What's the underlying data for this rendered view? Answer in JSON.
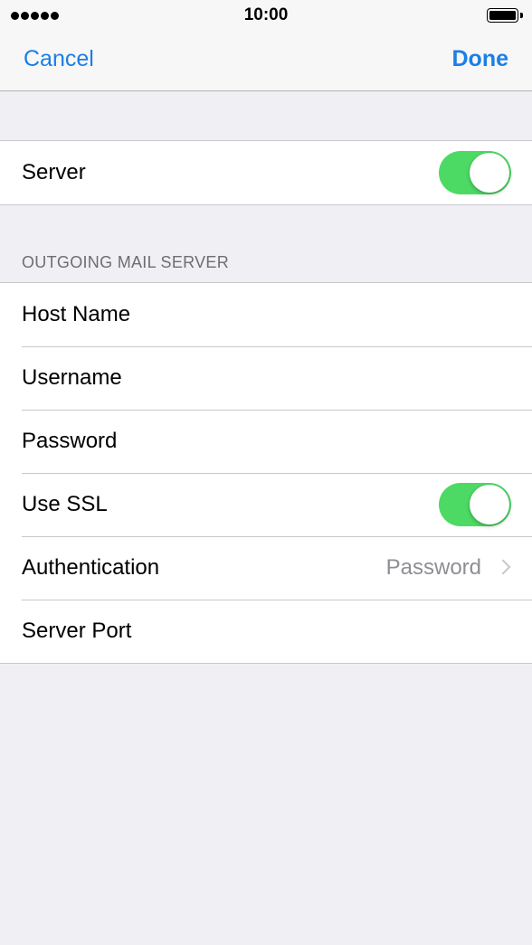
{
  "status_bar": {
    "time": "10:00",
    "signal_icon": "signal-dots-icon",
    "battery_icon": "battery-full-icon"
  },
  "nav": {
    "cancel_label": "Cancel",
    "done_label": "Done"
  },
  "server_row": {
    "label": "Server",
    "toggle_on": true
  },
  "outgoing": {
    "header": "OUTGOING MAIL SERVER",
    "host_name_label": "Host Name",
    "username_label": "Username",
    "password_label": "Password",
    "use_ssl_label": "Use SSL",
    "use_ssl_on": true,
    "authentication_label": "Authentication",
    "authentication_value": "Password",
    "server_port_label": "Server Port"
  },
  "colors": {
    "accent": "#1a7fe6",
    "toggle_on": "#4cd964",
    "background": "#efeff4",
    "secondary_text": "#8e8e93"
  }
}
